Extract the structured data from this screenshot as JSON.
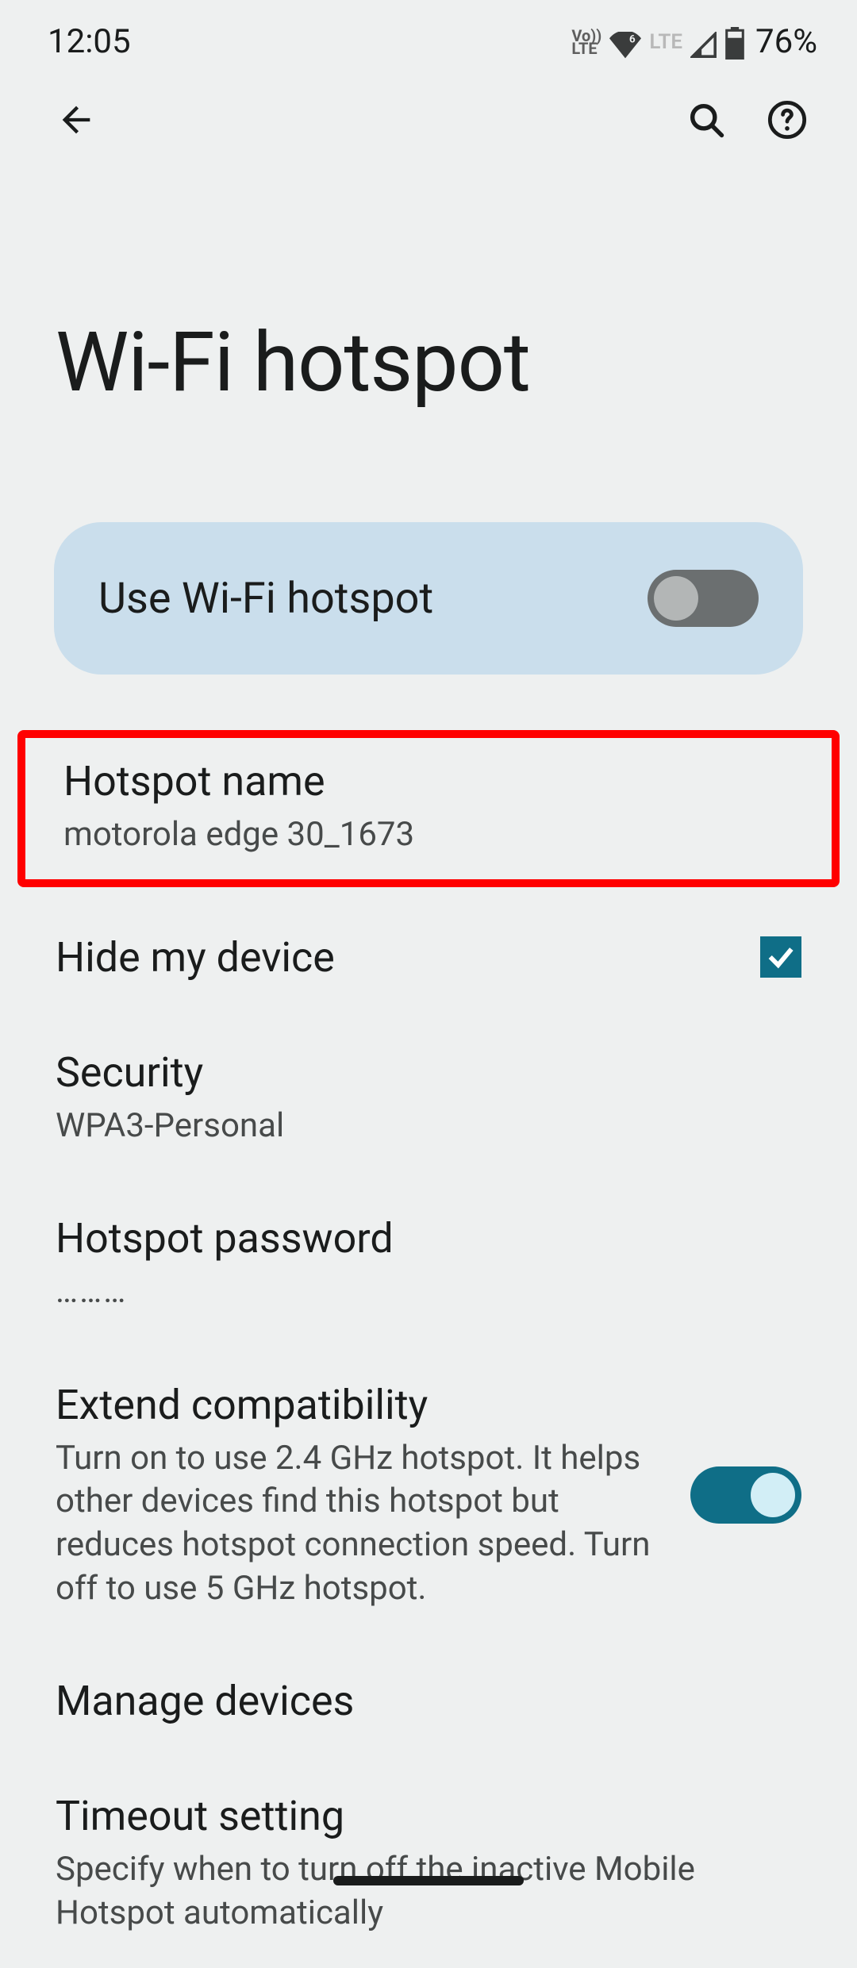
{
  "status_bar": {
    "time": "12:05",
    "volte": "Vo\nLTE",
    "lte": "LTE",
    "battery": "76%"
  },
  "page": {
    "title": "Wi-Fi hotspot"
  },
  "main_toggle": {
    "label": "Use Wi-Fi hotspot",
    "on": false
  },
  "hotspot_name": {
    "title": "Hotspot name",
    "value": "motorola edge 30_1673"
  },
  "hide_device": {
    "title": "Hide my device",
    "checked": true
  },
  "security": {
    "title": "Security",
    "value": "WPA3-Personal"
  },
  "password": {
    "title": "Hotspot password",
    "value": "………"
  },
  "compat": {
    "title": "Extend compatibility",
    "desc": "Turn on to use 2.4 GHz hotspot. It helps other devices find this hotspot but reduces hotspot connection speed. Turn off to use 5 GHz hotspot.",
    "on": true
  },
  "manage": {
    "title": "Manage devices"
  },
  "timeout": {
    "title": "Timeout setting",
    "desc": "Specify when to turn off the inactive Mobile Hotspot automatically"
  }
}
